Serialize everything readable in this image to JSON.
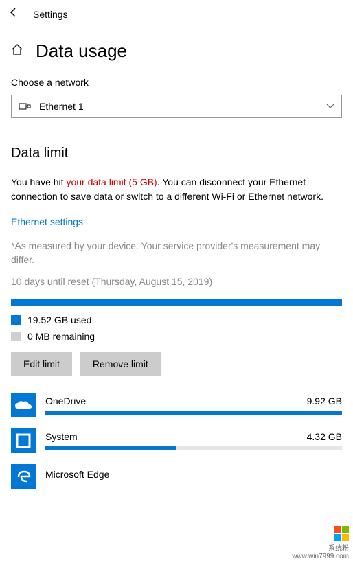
{
  "header": {
    "title": "Settings"
  },
  "page": {
    "title": "Data usage"
  },
  "network": {
    "label": "Choose a network",
    "selected": "Ethernet 1"
  },
  "data_limit": {
    "heading": "Data limit",
    "warning_prefix": "You have hit ",
    "warning_red": "your data limit (5 GB)",
    "warning_suffix": ".  You can disconnect your Ethernet connection to save data or switch to a different Wi-Fi or Ethernet network.",
    "settings_link": "Ethernet settings",
    "footnote": "*As measured by your device. Your service provider's measurement may differ.",
    "reset_text": "10 days until reset (Thursday, August 15, 2019)",
    "used_label": "19.52 GB used",
    "remaining_label": "0 MB remaining",
    "edit_button": "Edit limit",
    "remove_button": "Remove limit"
  },
  "apps": [
    {
      "name": "OneDrive",
      "usage": "9.92 GB",
      "bar_pct": 100
    },
    {
      "name": "System",
      "usage": "4.32 GB",
      "bar_pct": 44
    },
    {
      "name": "Microsoft Edge",
      "usage": "",
      "bar_pct": 0
    }
  ],
  "watermark": {
    "line1": "系统粉",
    "line2": "www.win7999.com"
  }
}
